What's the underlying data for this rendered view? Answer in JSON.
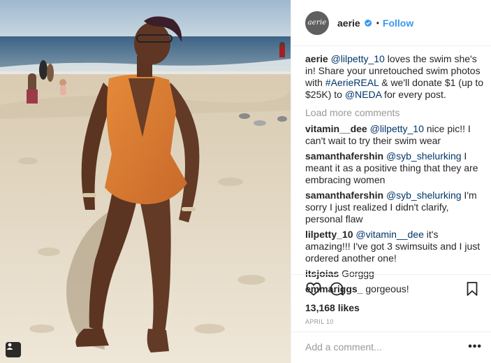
{
  "post": {
    "account": {
      "name": "aerie",
      "avatar_text": "aerie",
      "follow_label": "Follow",
      "separator": "•"
    },
    "caption": {
      "user": "aerie",
      "parts": [
        "@lilpetty_10",
        " loves the swim she's in! Share your unretouched swim photos with ",
        "#AerieREAL",
        " & we'll donate $1 (up to $25K) to ",
        "@NEDA",
        " for every post."
      ]
    },
    "load_more": "Load more comments",
    "comments": [
      {
        "user": "vitamin__dee",
        "mention": "@lilpetty_10",
        "text": " nice pic!! I can't wait to try their swim wear"
      },
      {
        "user": "samanthafershin",
        "mention": "@syb_shelurking",
        "text": " I meant it as a positive thing that they are embracing women"
      },
      {
        "user": "samanthafershin",
        "mention": "@syb_shelurking",
        "text": " I'm sorry I just realized I didn't clarify, personal flaw"
      },
      {
        "user": "lilpetty_10",
        "mention": "@vitamin__dee",
        "text": " it's amazing!!! I've got 3 swimsuits and I just ordered another one!"
      },
      {
        "user": "itsjoias",
        "mention": "",
        "text": "Gorggg"
      },
      {
        "user": "emmariggs_",
        "mention": "",
        "text": "gorgeous!"
      }
    ],
    "likes": "13,168 likes",
    "date": "APRIL 10",
    "add_comment_placeholder": "Add a comment...",
    "more_label": "•••",
    "icons": [
      "heart-icon",
      "comment-icon",
      "bookmark-icon",
      "user-tag-icon",
      "verified-badge-icon"
    ],
    "colors": {
      "link": "#003569",
      "follow": "#3897f0",
      "muted": "#999999",
      "verified": "#3897f0"
    }
  }
}
